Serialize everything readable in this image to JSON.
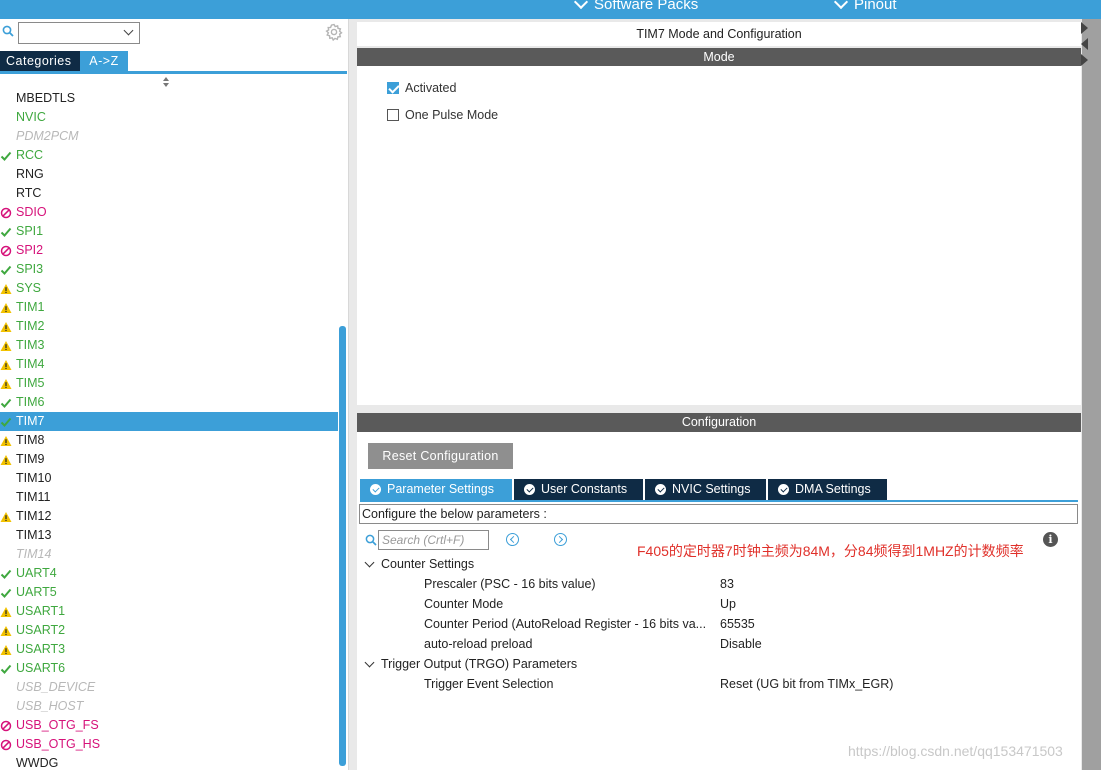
{
  "top_tabs": [
    {
      "label": "Software Packs"
    },
    {
      "label": "Pinout"
    }
  ],
  "left": {
    "select_value": "",
    "tabs": [
      {
        "label": "Categories",
        "active": false
      },
      {
        "label": "A->Z",
        "active": true
      }
    ],
    "peripherals": [
      {
        "label": "MBEDTLS",
        "status": "none",
        "style": "normal"
      },
      {
        "label": "NVIC",
        "status": "none",
        "style": "green"
      },
      {
        "label": "PDM2PCM",
        "status": "none",
        "style": "disabled"
      },
      {
        "label": "RCC",
        "status": "check",
        "style": "green"
      },
      {
        "label": "RNG",
        "status": "none",
        "style": "normal"
      },
      {
        "label": "RTC",
        "status": "none",
        "style": "normal"
      },
      {
        "label": "SDIO",
        "status": "blocked",
        "style": "pink"
      },
      {
        "label": "SPI1",
        "status": "check",
        "style": "green"
      },
      {
        "label": "SPI2",
        "status": "blocked",
        "style": "pink"
      },
      {
        "label": "SPI3",
        "status": "check",
        "style": "green"
      },
      {
        "label": "SYS",
        "status": "warning",
        "style": "green"
      },
      {
        "label": "TIM1",
        "status": "warning",
        "style": "green"
      },
      {
        "label": "TIM2",
        "status": "warning",
        "style": "green"
      },
      {
        "label": "TIM3",
        "status": "warning",
        "style": "green"
      },
      {
        "label": "TIM4",
        "status": "warning",
        "style": "green"
      },
      {
        "label": "TIM5",
        "status": "warning",
        "style": "green"
      },
      {
        "label": "TIM6",
        "status": "check",
        "style": "green"
      },
      {
        "label": "TIM7",
        "status": "check",
        "style": "selected"
      },
      {
        "label": "TIM8",
        "status": "warning",
        "style": "normal"
      },
      {
        "label": "TIM9",
        "status": "warning",
        "style": "normal"
      },
      {
        "label": "TIM10",
        "status": "none",
        "style": "normal"
      },
      {
        "label": "TIM11",
        "status": "none",
        "style": "normal"
      },
      {
        "label": "TIM12",
        "status": "warning",
        "style": "normal"
      },
      {
        "label": "TIM13",
        "status": "none",
        "style": "normal"
      },
      {
        "label": "TIM14",
        "status": "none",
        "style": "disabled"
      },
      {
        "label": "UART4",
        "status": "check",
        "style": "green"
      },
      {
        "label": "UART5",
        "status": "check",
        "style": "green"
      },
      {
        "label": "USART1",
        "status": "warning",
        "style": "green"
      },
      {
        "label": "USART2",
        "status": "warning",
        "style": "green"
      },
      {
        "label": "USART3",
        "status": "warning",
        "style": "green"
      },
      {
        "label": "USART6",
        "status": "check",
        "style": "green"
      },
      {
        "label": "USB_DEVICE",
        "status": "none",
        "style": "disabled"
      },
      {
        "label": "USB_HOST",
        "status": "none",
        "style": "disabled"
      },
      {
        "label": "USB_OTG_FS",
        "status": "blocked",
        "style": "pink"
      },
      {
        "label": "USB_OTG_HS",
        "status": "blocked",
        "style": "pink"
      },
      {
        "label": "WWDG",
        "status": "none",
        "style": "normal"
      }
    ]
  },
  "main": {
    "title": "TIM7 Mode and Configuration",
    "mode_header": "Mode",
    "mode_options": [
      {
        "label": "Activated",
        "checked": true
      },
      {
        "label": "One Pulse Mode",
        "checked": false
      }
    ],
    "config_header": "Configuration",
    "reset_label": "Reset Configuration",
    "config_tabs": [
      {
        "label": "Parameter Settings",
        "active": true
      },
      {
        "label": "User Constants",
        "active": false
      },
      {
        "label": "NVIC Settings",
        "active": false
      },
      {
        "label": "DMA Settings",
        "active": false
      }
    ],
    "config_desc": "Configure the below parameters :",
    "search_placeholder": "Search (Crtl+F)",
    "annotation": "F405的定时器7时钟主频为84M，分84频得到1MHZ的计数频率",
    "groups": [
      {
        "label": "Counter Settings",
        "params": [
          {
            "name": "Prescaler (PSC - 16 bits value)",
            "value": "83"
          },
          {
            "name": "Counter Mode",
            "value": "Up"
          },
          {
            "name": "Counter Period (AutoReload Register - 16 bits va...",
            "value": "65535"
          },
          {
            "name": "auto-reload preload",
            "value": "Disable"
          }
        ]
      },
      {
        "label": "Trigger Output (TRGO) Parameters",
        "params": [
          {
            "name": "Trigger Event Selection",
            "value": "Reset (UG bit from TIMx_EGR)"
          }
        ]
      }
    ],
    "watermark": "https://blog.csdn.net/qq153471503"
  },
  "colors": {
    "accent": "#3c9fd8",
    "dark_tab": "#0f2b45",
    "green": "#3fa83f",
    "pink": "#d6127a",
    "warning": "#f2c200",
    "annotation": "#e0302a"
  }
}
